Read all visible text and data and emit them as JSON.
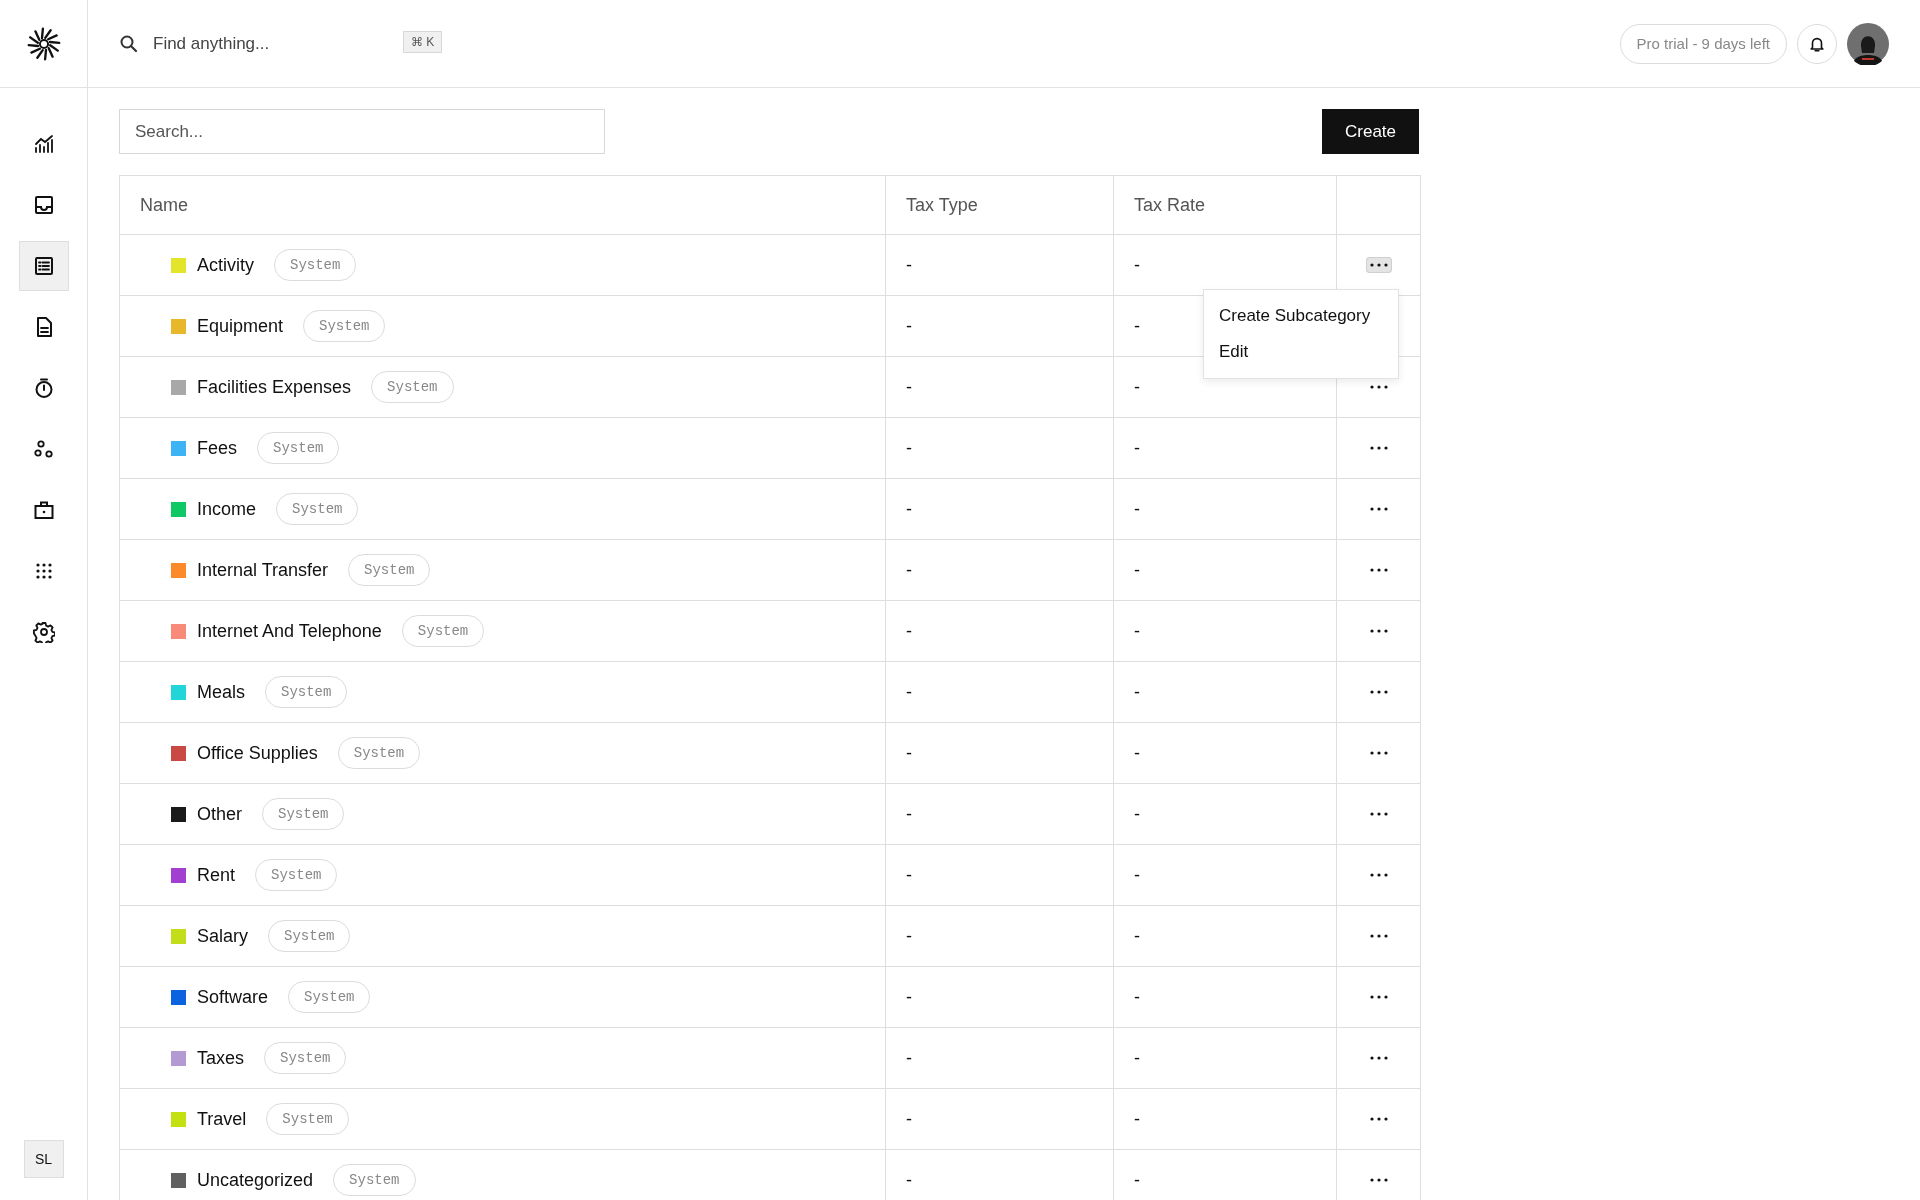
{
  "header": {
    "search": {
      "placeholder": "Find anything..."
    },
    "shortcut": "⌘ K",
    "trial_badge": "Pro trial - 9 days left"
  },
  "sidebar": {
    "items": [
      {
        "kind": "chart",
        "selected": false
      },
      {
        "kind": "inbox",
        "selected": false
      },
      {
        "kind": "list",
        "selected": true
      },
      {
        "kind": "document",
        "selected": false
      },
      {
        "kind": "timer",
        "selected": false
      },
      {
        "kind": "people",
        "selected": false
      },
      {
        "kind": "briefcase",
        "selected": false
      },
      {
        "kind": "apps",
        "selected": false
      },
      {
        "kind": "settings",
        "selected": false
      }
    ],
    "user_initials": "SL"
  },
  "toolbar": {
    "search": {
      "placeholder": "Search..."
    },
    "create_button": "Create"
  },
  "table": {
    "columns": [
      "Name",
      "Tax Type",
      "Tax Rate"
    ],
    "rows": [
      {
        "name": "Activity",
        "color": "#e3e52a",
        "badge": "System",
        "tax_type": "-",
        "tax_rate": "-",
        "menu_open": true
      },
      {
        "name": "Equipment",
        "color": "#e6b82a",
        "badge": "System",
        "tax_type": "-",
        "tax_rate": "-",
        "menu_open": false
      },
      {
        "name": "Facilities Expenses",
        "color": "#a8a8a8",
        "badge": "System",
        "tax_type": "-",
        "tax_rate": "-",
        "menu_open": false
      },
      {
        "name": "Fees",
        "color": "#3db3f5",
        "badge": "System",
        "tax_type": "-",
        "tax_rate": "-",
        "menu_open": false
      },
      {
        "name": "Income",
        "color": "#0ec765",
        "badge": "System",
        "tax_type": "-",
        "tax_rate": "-",
        "menu_open": false
      },
      {
        "name": "Internal Transfer",
        "color": "#fb8a2b",
        "badge": "System",
        "tax_type": "-",
        "tax_rate": "-",
        "menu_open": false
      },
      {
        "name": "Internet And Telephone",
        "color": "#f88a7a",
        "badge": "System",
        "tax_type": "-",
        "tax_rate": "-",
        "menu_open": false
      },
      {
        "name": "Meals",
        "color": "#22d5d8",
        "badge": "System",
        "tax_type": "-",
        "tax_rate": "-",
        "menu_open": false
      },
      {
        "name": "Office Supplies",
        "color": "#c94a44",
        "badge": "System",
        "tax_type": "-",
        "tax_rate": "-",
        "menu_open": false
      },
      {
        "name": "Other",
        "color": "#1a1a1a",
        "badge": "System",
        "tax_type": "-",
        "tax_rate": "-",
        "menu_open": false
      },
      {
        "name": "Rent",
        "color": "#a23fd1",
        "badge": "System",
        "tax_type": "-",
        "tax_rate": "-",
        "menu_open": false
      },
      {
        "name": "Salary",
        "color": "#c4dd1a",
        "badge": "System",
        "tax_type": "-",
        "tax_rate": "-",
        "menu_open": false
      },
      {
        "name": "Software",
        "color": "#0a64e0",
        "badge": "System",
        "tax_type": "-",
        "tax_rate": "-",
        "menu_open": false
      },
      {
        "name": "Taxes",
        "color": "#b39ad2",
        "badge": "System",
        "tax_type": "-",
        "tax_rate": "-",
        "menu_open": false
      },
      {
        "name": "Travel",
        "color": "#c4e010",
        "badge": "System",
        "tax_type": "-",
        "tax_rate": "-",
        "menu_open": false
      },
      {
        "name": "Uncategorized",
        "color": "#606060",
        "badge": "System",
        "tax_type": "-",
        "tax_rate": "-",
        "menu_open": false
      }
    ]
  },
  "row_menu": [
    "Create Subcategory",
    "Edit"
  ]
}
